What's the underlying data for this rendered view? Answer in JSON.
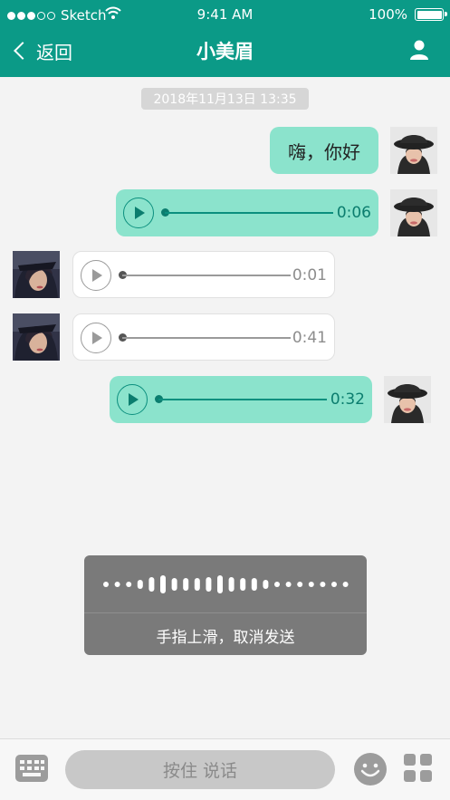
{
  "status_bar": {
    "carrier": "Sketch",
    "time": "9:41 AM",
    "battery": "100%",
    "signal_bars_filled": 3,
    "signal_bars_total": 5
  },
  "nav": {
    "back_label": "返回",
    "title": "小美眉",
    "profile_icon": "person-icon"
  },
  "timestamp": "2018年11月13日 13:35",
  "messages": [
    {
      "from": "me",
      "type": "text",
      "text": "嗨，你好"
    },
    {
      "from": "me",
      "type": "voice",
      "duration": "0:06"
    },
    {
      "from": "them",
      "type": "voice",
      "duration": "0:01"
    },
    {
      "from": "them",
      "type": "voice",
      "duration": "0:41"
    },
    {
      "from": "me",
      "type": "voice",
      "duration": "0:32"
    }
  ],
  "recording": {
    "hint": "手指上滑，取消发送"
  },
  "input_bar": {
    "talk_label": "按住 说话",
    "left_icon": "keyboard-icon",
    "emoji_icon": "emoji-icon",
    "more_icon": "more-icon"
  },
  "colors": {
    "header": "#0b9a87",
    "my_bubble": "#8be3cc",
    "their_bubble": "#ffffff",
    "background": "#f3f3f3"
  }
}
